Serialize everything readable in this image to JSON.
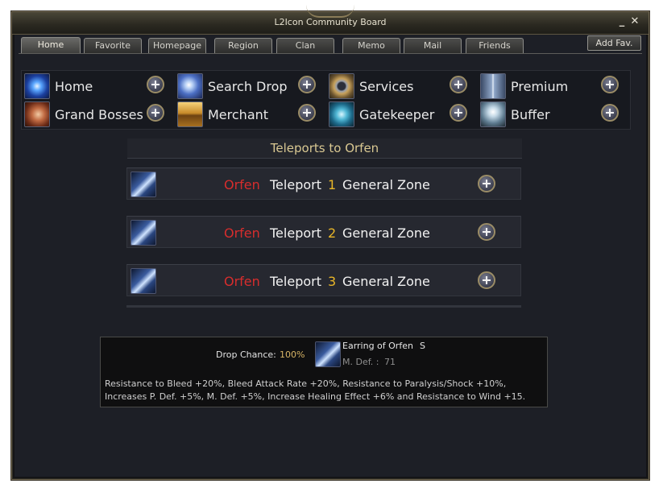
{
  "window": {
    "title": "L2Icon Community Board",
    "minimize_glyph": "_",
    "close_glyph": "✕"
  },
  "tabs": [
    "Home",
    "Favorite",
    "Homepage",
    "Region",
    "Clan",
    "Memo",
    "Mail",
    "Friends"
  ],
  "active_tab": "Home",
  "add_fav_label": "Add Fav.",
  "nav": {
    "items": [
      {
        "label": "Home",
        "icon": "home-skill-icon"
      },
      {
        "label": "Search Drop",
        "icon": "search-drop-icon"
      },
      {
        "label": "Services",
        "icon": "services-gear-icon"
      },
      {
        "label": "Premium",
        "icon": "premium-icon"
      },
      {
        "label": "Grand Bosses",
        "icon": "grand-bosses-icon"
      },
      {
        "label": "Merchant",
        "icon": "merchant-chest-icon"
      },
      {
        "label": "Gatekeeper",
        "icon": "gatekeeper-swirl-icon"
      },
      {
        "label": "Buffer",
        "icon": "buffer-icon"
      }
    ]
  },
  "section_title": "Teleports to Orfen",
  "teleports": [
    {
      "city": "Orfen",
      "word": "Teleport",
      "number": "1",
      "zone": "General Zone"
    },
    {
      "city": "Orfen",
      "word": "Teleport",
      "number": "2",
      "zone": "General Zone"
    },
    {
      "city": "Orfen",
      "word": "Teleport",
      "number": "3",
      "zone": "General Zone"
    }
  ],
  "item": {
    "drop_label": "Drop Chance:",
    "drop_value": "100%",
    "name": "Earring of Orfen",
    "grade": "S",
    "mdef_label": "M. Def. :",
    "mdef_value": "71",
    "description": "Resistance to Bleed +20%, Bleed Attack Rate +20%, Resistance to Paralysis/Shock +10%, Increases P. Def. +5%, M. Def. +5%, Increase Healing Effect +6% and Resistance to Wind +15."
  },
  "colors": {
    "city": "#d72d2d",
    "number": "#e9b628",
    "section_title": "#d9c892",
    "drop_value": "#d8b566"
  }
}
